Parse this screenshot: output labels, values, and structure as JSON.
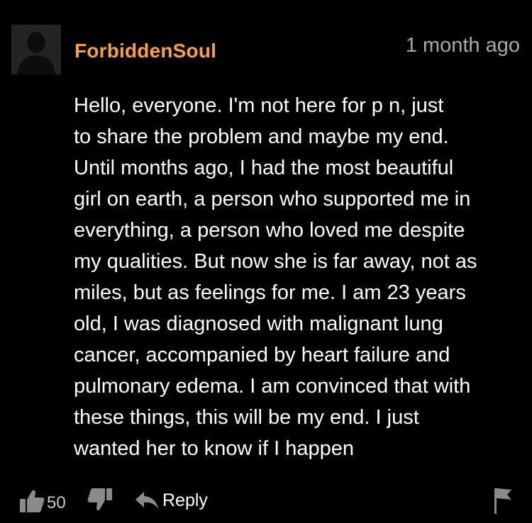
{
  "comment": {
    "username": "ForbiddenSoul",
    "username_color": "#f7a046",
    "timestamp": "1 month ago",
    "lines": [
      "Hello, everyone. I'm not here for p   n, just",
      "to share the problem and maybe my end.",
      "Until months ago, I had the most beautiful",
      "girl on earth, a person who supported me in",
      "everything, a person who loved me despite",
      "my qualities. But now she is far away, not as",
      "miles, but as feelings for me. I am 23 years",
      "old, I was diagnosed with malignant lung",
      "cancer, accompanied by heart failure and",
      "pulmonary edema. I am convinced that with",
      "these things, this will be my end. I just",
      "wanted her to know if I happen"
    ]
  },
  "actions": {
    "upvote_icon": "thumbs-up-icon",
    "vote_count": "50",
    "downvote_icon": "thumbs-down-icon",
    "reply_icon": "reply-arrow-icon",
    "reply_label": "Reply",
    "flag_icon": "flag-icon"
  },
  "colors": {
    "background": "#000000",
    "text": "#ffffff",
    "muted": "#a8a8a8",
    "icon": "#8a8a8a"
  }
}
